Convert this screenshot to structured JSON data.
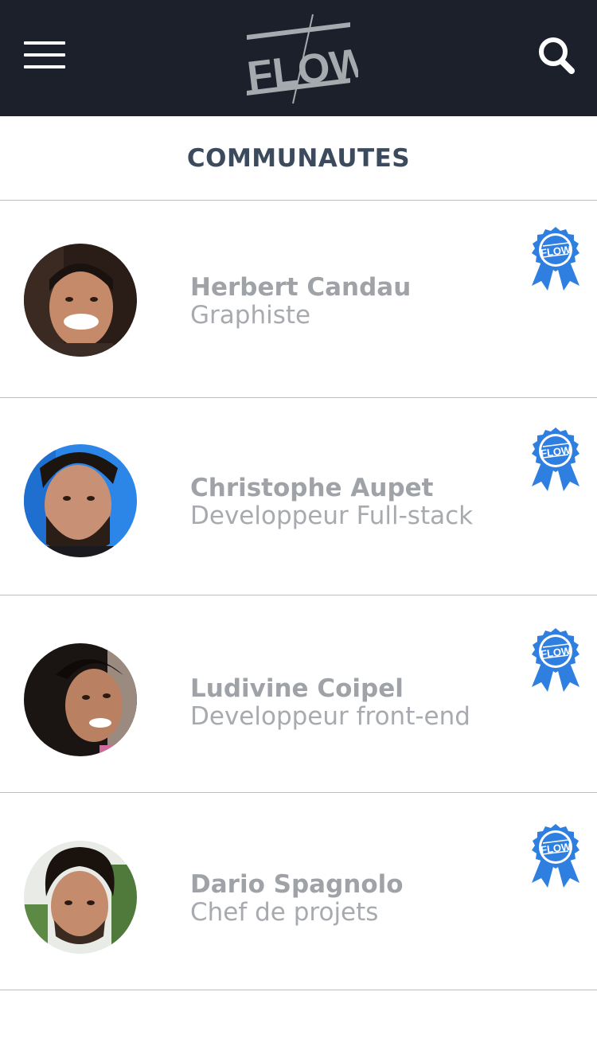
{
  "header": {
    "logo_text": "FLOW",
    "menu_icon": "hamburger-menu-icon",
    "search_icon": "search-icon",
    "background": "#1b202b"
  },
  "section": {
    "title": "COMMUNAUTES",
    "title_color": "#3b4a5c"
  },
  "members": [
    {
      "name": "Herbert Candau",
      "role": "Graphiste",
      "badge_text": "FLOW",
      "badge_icon": "ribbon-badge-icon"
    },
    {
      "name": "Christophe Aupet",
      "role": "Developpeur Full-stack",
      "badge_text": "FLOW",
      "badge_icon": "ribbon-badge-icon"
    },
    {
      "name": "Ludivine Coipel",
      "role": "Developpeur front-end",
      "badge_text": "FLOW",
      "badge_icon": "ribbon-badge-icon"
    },
    {
      "name": "Dario Spagnolo",
      "role": "Chef de projets",
      "badge_text": "FLOW",
      "badge_icon": "ribbon-badge-icon"
    }
  ],
  "colors": {
    "badge_blue": "#2f7fe0",
    "text_grey": "#9fa3a8",
    "divider": "#b4c0c7"
  }
}
